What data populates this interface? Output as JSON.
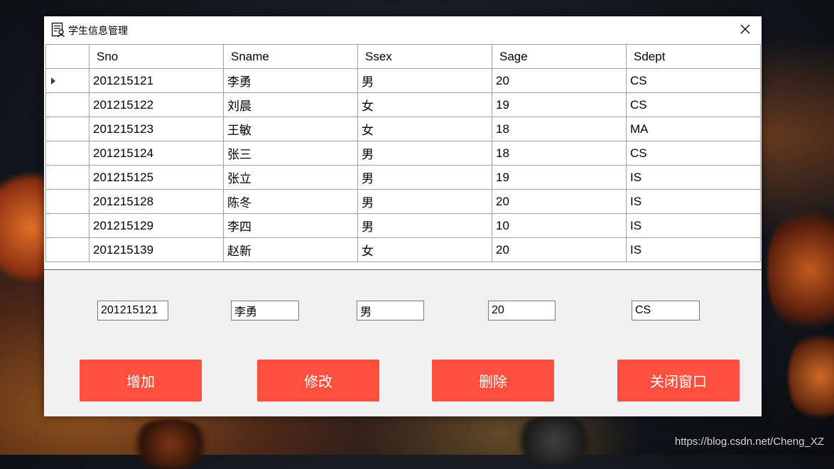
{
  "window": {
    "title": "学生信息管理",
    "close_glyph": "✕"
  },
  "grid": {
    "columns": [
      "Sno",
      "Sname",
      "Ssex",
      "Sage",
      "Sdept"
    ],
    "rows": [
      [
        "201215121",
        "李勇",
        "男",
        "20",
        "CS"
      ],
      [
        "201215122",
        "刘晨",
        "女",
        "19",
        "CS"
      ],
      [
        "201215123",
        "王敏",
        "女",
        "18",
        "MA"
      ],
      [
        "201215124",
        "张三",
        "男",
        "18",
        "CS"
      ],
      [
        "201215125",
        "张立",
        "男",
        "19",
        "IS"
      ],
      [
        "201215128",
        "陈冬",
        "男",
        "20",
        "IS"
      ],
      [
        "201215129",
        "李四",
        "男",
        "10",
        "IS"
      ],
      [
        "201215139",
        "赵新",
        "女",
        "20",
        "IS"
      ]
    ]
  },
  "form": {
    "sno_value": "201215121",
    "sname_value": "李勇",
    "ssex_value": "男",
    "sage_value": "20",
    "sdept_value": "CS"
  },
  "buttons": {
    "add_label": "增加",
    "modify_label": "修改",
    "delete_label": "删除",
    "close_window_label": "关闭窗口"
  },
  "colors": {
    "button_bg": "#fe4f3f",
    "button_text": "#ffffff"
  },
  "watermark": "https://blog.csdn.net/Cheng_XZ"
}
